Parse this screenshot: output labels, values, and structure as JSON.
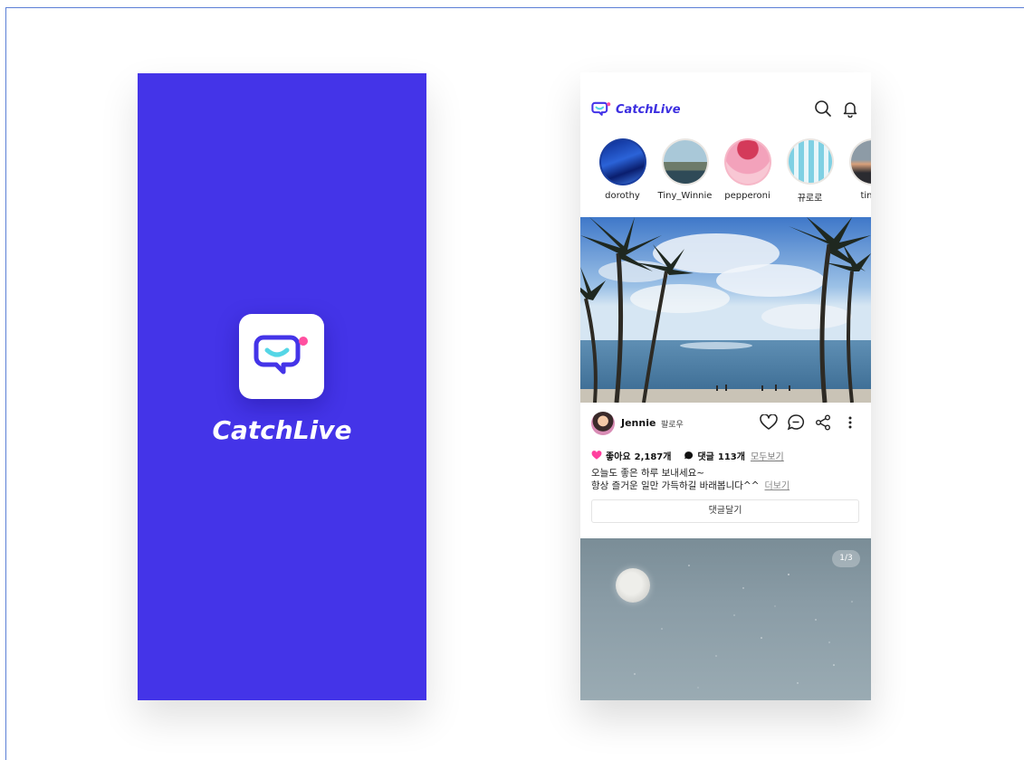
{
  "app": {
    "name": "CatchLive",
    "brand_color": "#4434e8"
  },
  "splash": {
    "title": "CatchLive",
    "icon": "chat-bubble-logo-icon"
  },
  "header": {
    "logo_text": "CatchLive",
    "icons": [
      "search-icon",
      "bell-icon"
    ]
  },
  "stories": [
    {
      "name": "dorothy"
    },
    {
      "name": "Tiny_Winnie"
    },
    {
      "name": "pepperoni"
    },
    {
      "name": "뀨로로"
    },
    {
      "name": "tingti"
    }
  ],
  "post": {
    "username": "Jennie",
    "follow_label": "팔로우",
    "likes_label": "좋아요",
    "likes_count": "2,187개",
    "comments_label": "댓글",
    "comments_count": "113개",
    "view_all_label": "모두보기",
    "caption_line1": "오늘도 좋은 하루 보내세요~",
    "caption_line2": "항상 즐거운 일만 가득하길 바래봅니다^^",
    "more_label": "더보기",
    "comment_button_label": "댓글달기",
    "actions": [
      "heart-icon",
      "comment-icon",
      "share-icon",
      "more-vertical-icon"
    ]
  },
  "post2": {
    "counter": "1/3"
  }
}
